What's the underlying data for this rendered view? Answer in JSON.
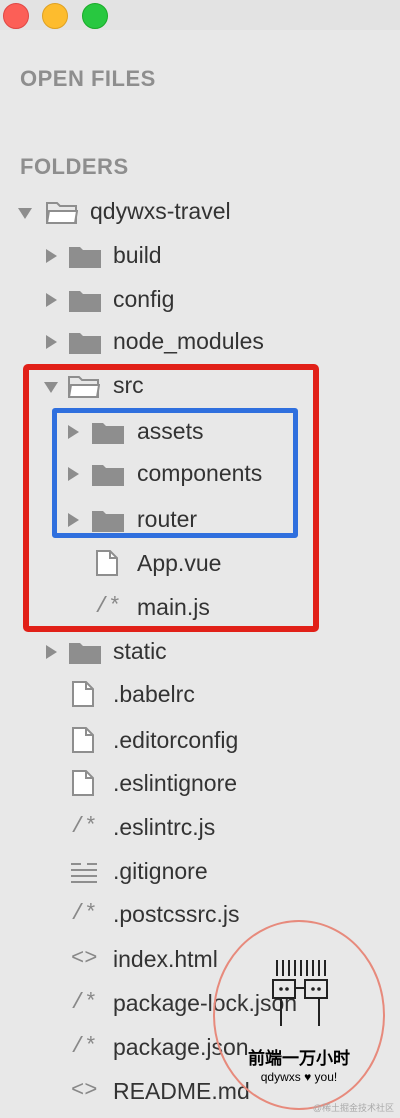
{
  "window": {
    "controls": [
      "close",
      "minimize",
      "zoom"
    ]
  },
  "sections": {
    "open_files": "OPEN FILES",
    "folders": "FOLDERS"
  },
  "tree": {
    "root": {
      "label": "qdywxs-travel"
    },
    "build": {
      "label": "build"
    },
    "config": {
      "label": "config"
    },
    "node_modules": {
      "label": "node_modules"
    },
    "src": {
      "label": "src"
    },
    "assets": {
      "label": "assets"
    },
    "components": {
      "label": "components"
    },
    "router": {
      "label": "router"
    },
    "app_vue": {
      "label": "App.vue"
    },
    "main_js": {
      "label": "main.js"
    },
    "static": {
      "label": "static"
    },
    "babelrc": {
      "label": ".babelrc"
    },
    "editorconfig": {
      "label": ".editorconfig"
    },
    "eslintignore": {
      "label": ".eslintignore"
    },
    "eslintrc": {
      "label": ".eslintrc.js"
    },
    "gitignore": {
      "label": ".gitignore"
    },
    "postcssrc": {
      "label": ".postcssrc.js"
    },
    "index_html": {
      "label": "index.html"
    },
    "package_lock": {
      "label": "package-lock.json"
    },
    "package_json": {
      "label": "package.json"
    },
    "readme": {
      "label": "README.md"
    }
  },
  "glyphs": {
    "comment": "/*",
    "code": "<>"
  },
  "icons": [
    "folder-icon",
    "folder-open-icon",
    "file-icon",
    "lines-icon",
    "code-icon",
    "comment-icon",
    "chevron-right-icon",
    "chevron-down-icon"
  ],
  "colors": {
    "highlight_red": "#e12018",
    "highlight_blue": "#2f6fde",
    "folder_gray": "#8e8e8e"
  },
  "stamp": {
    "title": "前端一万小时",
    "subtitle": "qdywxs ♥ you!"
  },
  "watermark": "@稀土掘金技术社区"
}
